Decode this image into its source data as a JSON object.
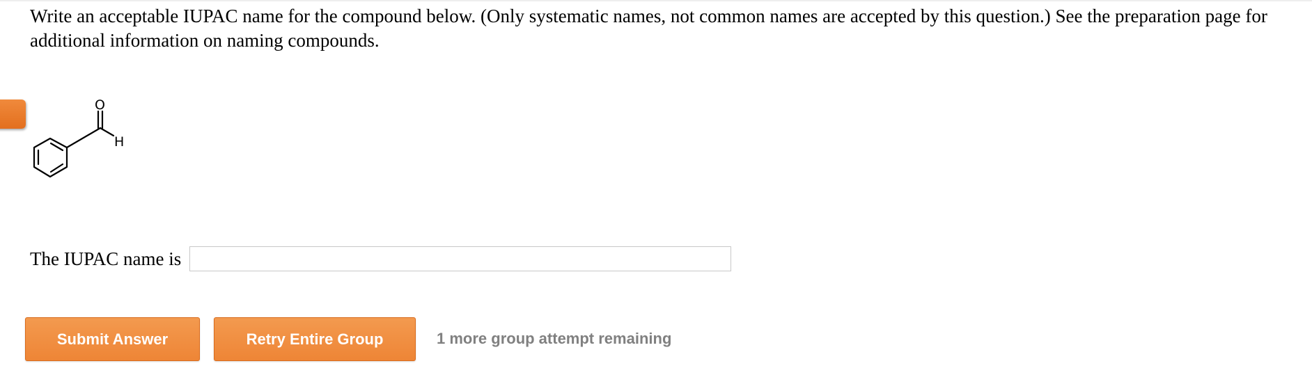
{
  "question": {
    "text": "Write an acceptable IUPAC name for the compound below. (Only systematic names, not common names are accepted by this question.) See the preparation page for additional information on naming compounds."
  },
  "structure": {
    "oxygen_label": "O",
    "hydrogen_label": "H"
  },
  "answer": {
    "label": "The IUPAC name is",
    "value": "",
    "placeholder": ""
  },
  "actions": {
    "submit_label": "Submit Answer",
    "retry_label": "Retry Entire Group",
    "attempts_text": "1 more group attempt remaining"
  },
  "colors": {
    "button_orange": "#ee8536",
    "tab_orange": "#e8772a",
    "muted_text": "#808080"
  }
}
